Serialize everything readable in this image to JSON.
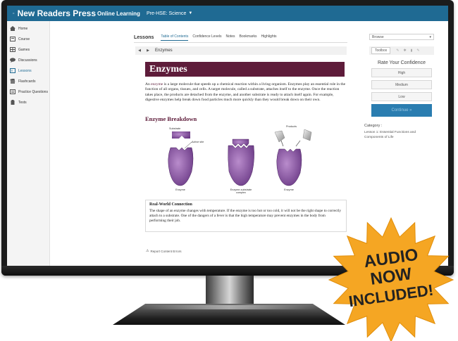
{
  "app": {
    "brand": "New Readers Press",
    "nav_primary": "Online Learning",
    "nav_level": "Pre-HSE: Science"
  },
  "sidebar": {
    "items": [
      {
        "label": "Home",
        "icon": "home-icon"
      },
      {
        "label": "Course",
        "icon": "course-icon"
      },
      {
        "label": "Games",
        "icon": "games-icon"
      },
      {
        "label": "Discussions",
        "icon": "discussions-icon"
      },
      {
        "label": "Lessons",
        "icon": "lessons-icon",
        "active": true
      },
      {
        "label": "Flashcards",
        "icon": "flashcards-icon"
      },
      {
        "label": "Practice Questions",
        "icon": "practice-questions-icon"
      },
      {
        "label": "Tests",
        "icon": "tests-icon"
      }
    ]
  },
  "lessons": {
    "title": "Lessons",
    "tabs": [
      "Table of Contents",
      "Confidence Levels",
      "Notes",
      "Bookmarks",
      "Highlights"
    ],
    "active_tab": "Table of Contents",
    "current_topic": "Enzymes"
  },
  "browse": {
    "label": "Browse"
  },
  "toolbox": {
    "label": "Toolbox"
  },
  "content": {
    "heading": "Enzymes",
    "intro_term": "enzyme",
    "intro_before": "An ",
    "intro_after": " is a large molecule that speeds up a chemical reaction within a living organism. Enzymes play an essential role in the function of all organs, tissues, and cells. A target molecule, called a substrate, attaches itself to the enzyme. Once the reaction takes place, the products are detached from the enzyme, and another substrate is ready to attach itself again. For example, digestive enzymes help break down food particles much more quickly than they would break down on their own.",
    "subheading": "Enzyme Breakdown",
    "diagram_labels": {
      "substrate": "Substrate",
      "active_site": "Active site",
      "products": "Products",
      "enzyme_1": "Enzyme",
      "complex": "Enzyme-substrate complex",
      "enzyme_2": "Enzyme"
    },
    "rwc_title": "Real-World Connection",
    "rwc_body": "The shape of an enzyme changes with temperature. If the enzyme is too hot or too cold, it will not be the right shape to correctly attach to a substrate. One of the dangers of a fever is that the high temperature may prevent enzymes in the body from performing their job.",
    "report_label": "Report Content Errors"
  },
  "confidence": {
    "title": "Rate Your Confidence",
    "options": [
      "High",
      "Medium",
      "Low"
    ],
    "continue": "Continue »",
    "category_label": "Category :",
    "category_value": "Lesson 1: Essential Functions and Components of Life"
  },
  "badge": {
    "lines": [
      "AUDIO",
      "NOW",
      "INCLUDED!"
    ],
    "color": "#f5a623"
  },
  "colors": {
    "topbar": "#1f6a93",
    "heading_band": "#5e1c3a",
    "continue_button": "#2a7db0"
  }
}
